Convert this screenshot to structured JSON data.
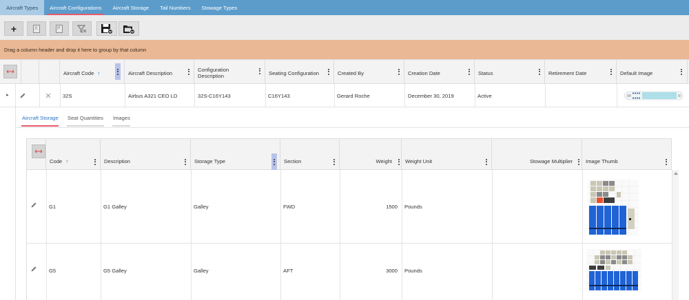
{
  "top_tabs": [
    "Aircraft Types",
    "Aircraft Configurations",
    "Aircraft Storage",
    "Tail Numbers",
    "Stowage Types"
  ],
  "active_top_tab": "Aircraft Configurations",
  "toolbar": {
    "buttons": [
      {
        "icon": "add-icon",
        "glyph": "+"
      },
      {
        "icon": "excel-export-icon",
        "glyph": "X"
      },
      {
        "icon": "pdf-export-icon",
        "glyph": "P"
      },
      {
        "icon": "clear-filter-icon",
        "glyph": ""
      },
      {
        "icon": "save-layout-icon",
        "glyph": ""
      },
      {
        "icon": "load-layout-icon",
        "glyph": ""
      }
    ]
  },
  "group_panel_text": "Drag a column header and drop it here to group by that column",
  "main_grid": {
    "columns": [
      "Aircraft Code",
      "Aircraft Description",
      "Configuration Description",
      "Seating Configuration",
      "Created By",
      "Creation Date",
      "Status",
      "Retirement Date",
      "Default Image"
    ],
    "config_desc_lines": [
      "Configuration",
      "Description"
    ],
    "row": {
      "aircraft_code": "32S",
      "aircraft_description": "Airbus A321 CEO LD",
      "configuration_description": "32S-C16Y143",
      "seating_configuration": "C16Y143",
      "created_by": "Gerard Roche",
      "creation_date": "December 30, 2019",
      "status": "Active",
      "retirement_date": ""
    }
  },
  "detail_tabs": [
    "Aircraft Storage",
    "Seat Quantities",
    "Images"
  ],
  "active_detail_tab": "Aircraft Storage",
  "storage_grid": {
    "columns": [
      "Code",
      "Description",
      "Storage Type",
      "Section",
      "Weight",
      "Weight Unit",
      "Stowage Multiplier",
      "Image Thumb"
    ],
    "rows": [
      {
        "code": "G1",
        "description": "G1 Galley",
        "storage_type": "Galley",
        "section": "FWD",
        "weight": "1500",
        "weight_unit": "Pounds",
        "stowage_multiplier": ""
      },
      {
        "code": "G5",
        "description": "G5 Galley",
        "storage_type": "Galley",
        "section": "AFT",
        "weight": "3000",
        "weight_unit": "Pounds",
        "stowage_multiplier": ""
      }
    ]
  },
  "colors": {
    "top_bar": "#5b9ccb",
    "active_tab_underline": "#e7586a",
    "group_panel": "#eab894",
    "sort_arrow": "#2b74c7",
    "galley_cart_blue": "#1f63d6",
    "galley_accent_red": "#e8502d"
  }
}
